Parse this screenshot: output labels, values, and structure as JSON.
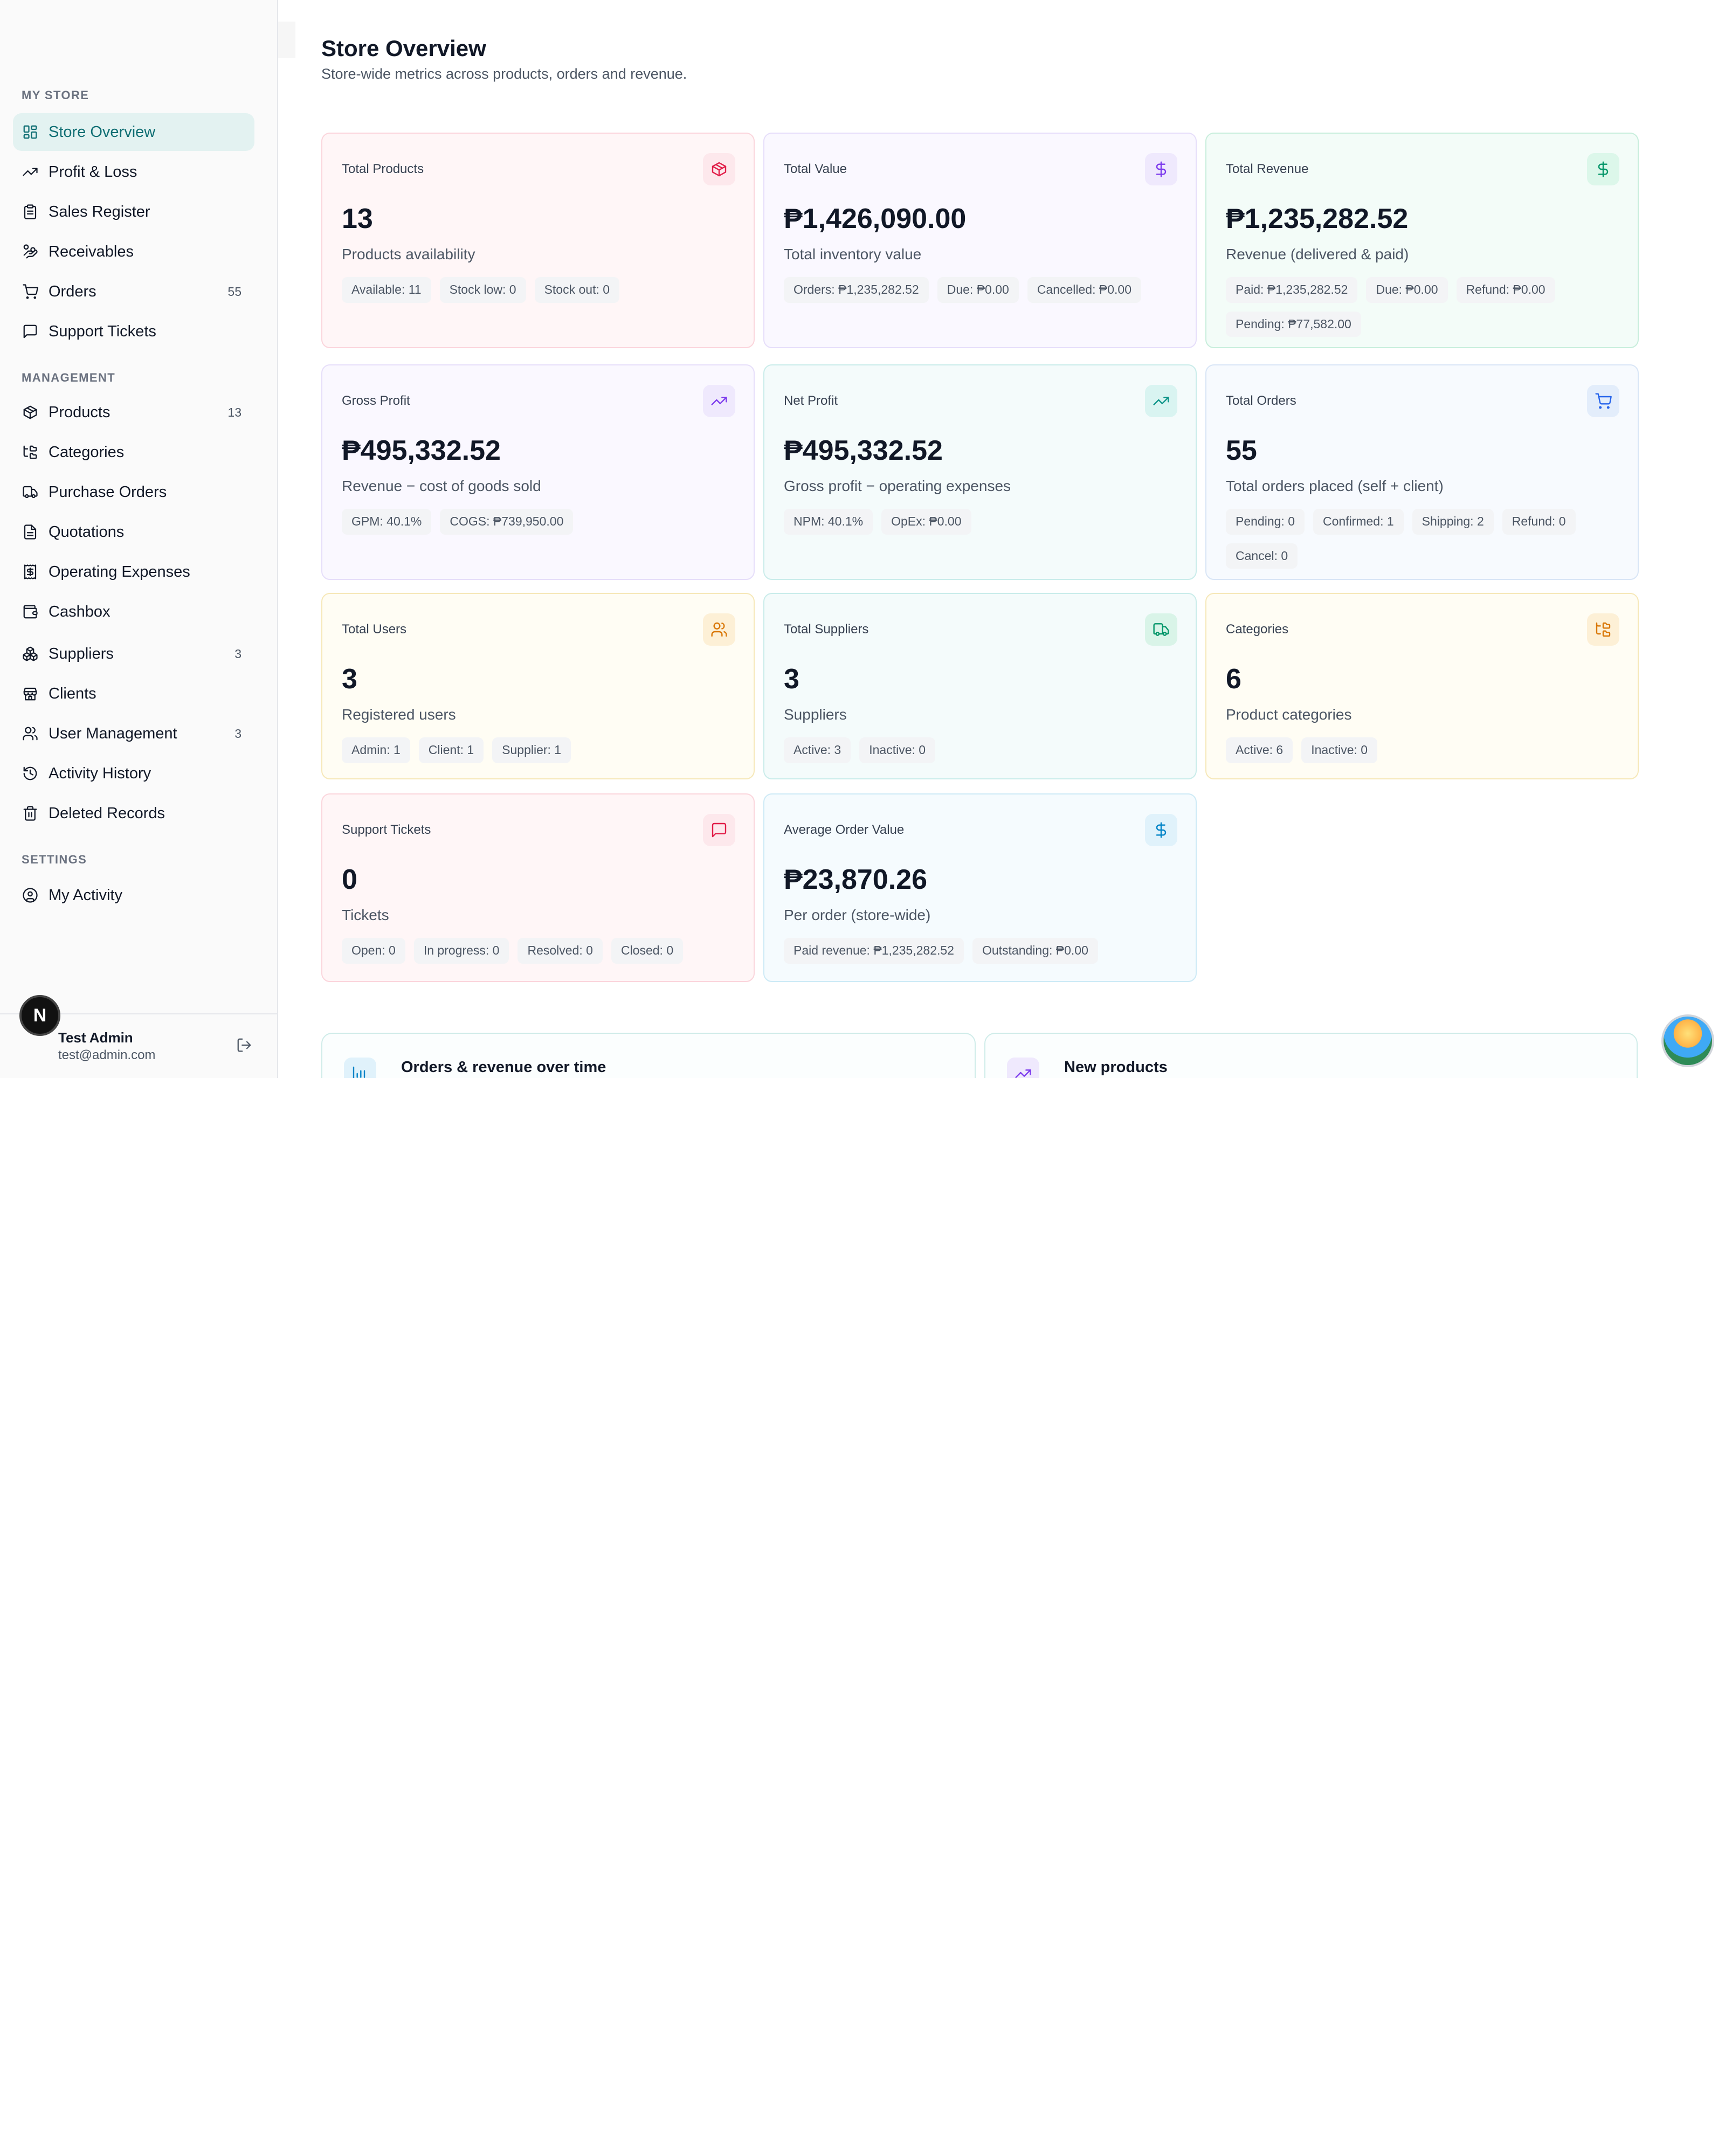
{
  "sidebar": {
    "sections": {
      "my_store": "MY STORE",
      "management": "MANAGEMENT",
      "settings": "SETTINGS"
    },
    "items": [
      {
        "label": "Store Overview",
        "icon": "grid-icon",
        "count": ""
      },
      {
        "label": "Profit & Loss",
        "icon": "trend-up-icon",
        "count": ""
      },
      {
        "label": "Sales Register",
        "icon": "clipboard-icon",
        "count": ""
      },
      {
        "label": "Receivables",
        "icon": "hand-coins-icon",
        "count": ""
      },
      {
        "label": "Orders",
        "icon": "cart-icon",
        "count": "55"
      },
      {
        "label": "Support Tickets",
        "icon": "message-icon",
        "count": ""
      },
      {
        "label": "Products",
        "icon": "package-icon",
        "count": "13"
      },
      {
        "label": "Categories",
        "icon": "folder-tree-icon",
        "count": ""
      },
      {
        "label": "Purchase Orders",
        "icon": "truck-icon",
        "count": ""
      },
      {
        "label": "Quotations",
        "icon": "file-icon",
        "count": ""
      },
      {
        "label": "Operating Expenses",
        "icon": "receipt-icon",
        "count": ""
      },
      {
        "label": "Cashbox",
        "icon": "wallet-icon",
        "count": ""
      },
      {
        "label": "Suppliers",
        "icon": "boxes-icon",
        "count": "3"
      },
      {
        "label": "Clients",
        "icon": "store-icon",
        "count": ""
      },
      {
        "label": "User Management",
        "icon": "users-icon",
        "count": "3"
      },
      {
        "label": "Activity History",
        "icon": "history-icon",
        "count": ""
      },
      {
        "label": "Deleted Records",
        "icon": "trash-icon",
        "count": ""
      },
      {
        "label": "My Activity",
        "icon": "user-circle-icon",
        "count": ""
      }
    ],
    "user": {
      "initial": "N",
      "name": "Test Admin",
      "email": "test@admin.com"
    }
  },
  "main": {
    "title": "Store Overview",
    "subtitle": "Store-wide metrics across products, orders and revenue.",
    "cards": [
      {
        "title": "Total Products",
        "value": "13",
        "desc": "Products availability",
        "icon": "package-icon",
        "accent": "#e11d48",
        "chips": [
          "Available: 11",
          "Stock low: 0",
          "Stock out: 0"
        ]
      },
      {
        "title": "Total Value",
        "value": "₱1,426,090.00",
        "desc": "Total inventory value",
        "icon": "dollar-icon",
        "accent": "#7c3aed",
        "chips": [
          "Orders: ₱1,235,282.52",
          "Due: ₱0.00",
          "Cancelled: ₱0.00"
        ]
      },
      {
        "title": "Total Revenue",
        "value": "₱1,235,282.52",
        "desc": "Revenue (delivered & paid)",
        "icon": "dollar-icon",
        "accent": "#059669",
        "chips": [
          "Paid: ₱1,235,282.52",
          "Due: ₱0.00",
          "Refund: ₱0.00",
          "Pending: ₱77,582.00"
        ]
      },
      {
        "title": "Gross Profit",
        "value": "₱495,332.52",
        "desc": "Revenue − cost of goods sold",
        "icon": "trend-up-icon",
        "accent": "#7c3aed",
        "chips": [
          "GPM: 40.1%",
          "COGS: ₱739,950.00"
        ]
      },
      {
        "title": "Net Profit",
        "value": "₱495,332.52",
        "desc": "Gross profit − operating expenses",
        "icon": "trend-up-icon",
        "accent": "#0d9488",
        "chips": [
          "NPM: 40.1%",
          "OpEx: ₱0.00"
        ]
      },
      {
        "title": "Total Orders",
        "value": "55",
        "desc": "Total orders placed (self + client)",
        "icon": "cart-icon",
        "accent": "#2563eb",
        "chips": [
          "Pending: 0",
          "Confirmed: 1",
          "Shipping: 2",
          "Refund: 0",
          "Cancel: 0"
        ]
      },
      {
        "title": "Total Users",
        "value": "3",
        "desc": "Registered users",
        "icon": "users-icon",
        "accent": "#d97706",
        "chips": [
          "Admin: 1",
          "Client: 1",
          "Supplier: 1"
        ]
      },
      {
        "title": "Total Suppliers",
        "value": "3",
        "desc": "Suppliers",
        "icon": "truck-icon",
        "accent": "#059669",
        "chips": [
          "Active: 3",
          "Inactive: 0"
        ]
      },
      {
        "title": "Categories",
        "value": "6",
        "desc": "Product categories",
        "icon": "folder-tree-icon",
        "accent": "#d97706",
        "chips": [
          "Active: 6",
          "Inactive: 0"
        ]
      },
      {
        "title": "Support Tickets",
        "value": "0",
        "desc": "Tickets",
        "icon": "message-icon",
        "accent": "#e11d48",
        "chips": [
          "Open: 0",
          "In progress: 0",
          "Resolved: 0",
          "Closed: 0"
        ]
      },
      {
        "title": "Average Order Value",
        "value": "₱23,870.26",
        "desc": "Per order (store-wide)",
        "icon": "dollar-icon",
        "accent": "#0284c7",
        "chips": [
          "Paid revenue: ₱1,235,282.52",
          "Outstanding: ₱0.00"
        ]
      }
    ],
    "bottom": [
      {
        "title": "Orders & revenue over time",
        "icon": "bar-chart-icon",
        "accent": "#0284c7"
      },
      {
        "title": "New products",
        "icon": "trend-up-icon",
        "accent": "#7c3aed"
      }
    ]
  }
}
